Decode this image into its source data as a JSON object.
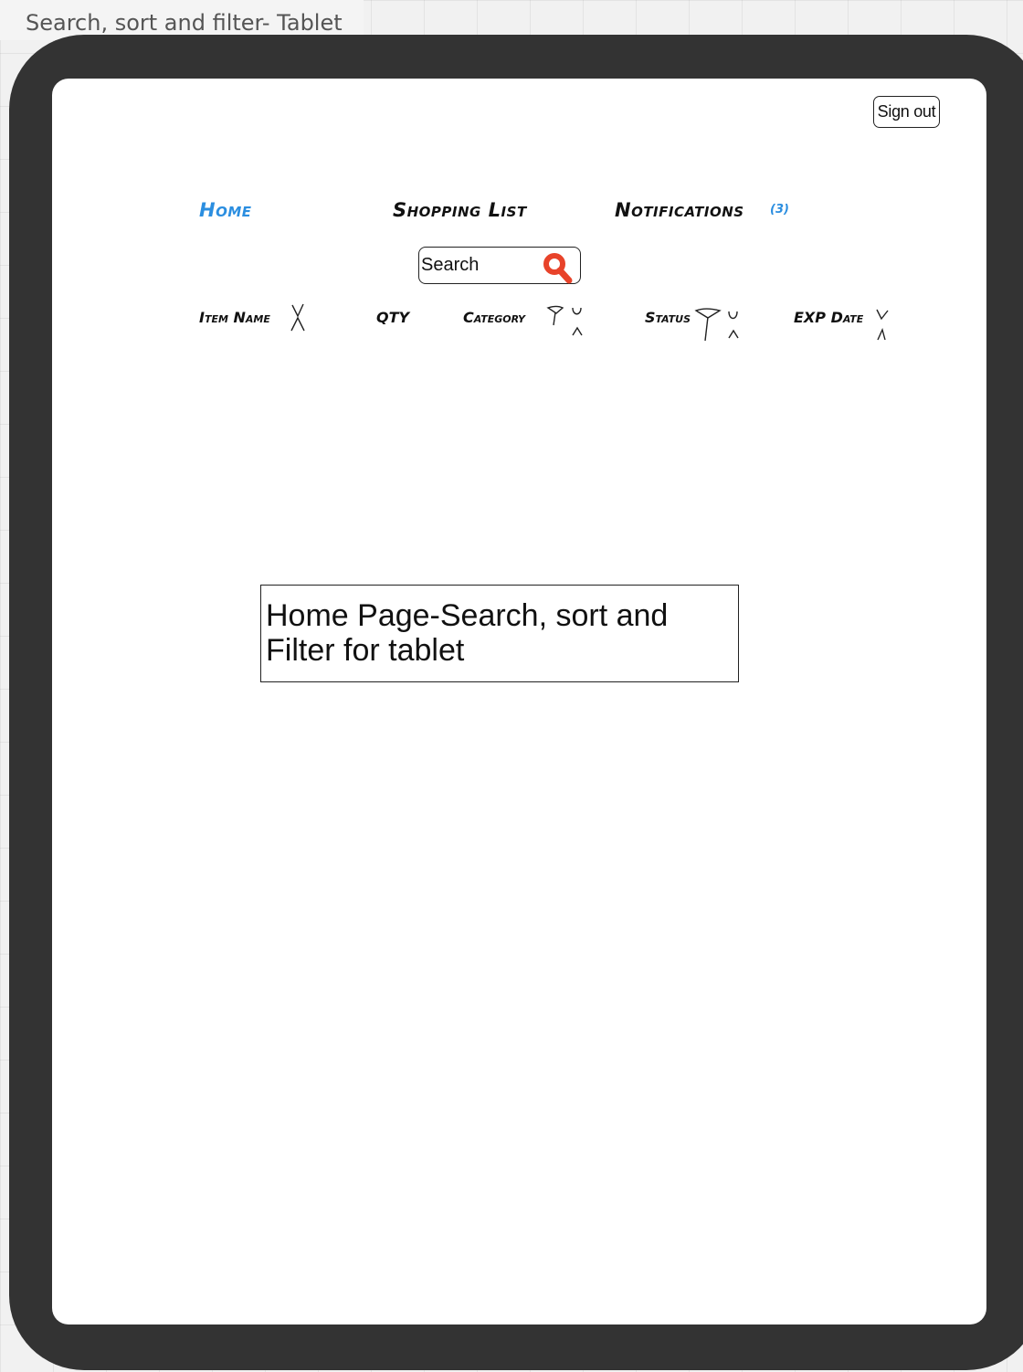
{
  "frame": {
    "title": "Search, sort and filter- Tablet"
  },
  "header": {
    "signout_label": "Sign out"
  },
  "nav": {
    "home": "Home",
    "shopping_list": "Shopping List",
    "notifications": "Notifications",
    "notifications_count": "(3)"
  },
  "search": {
    "placeholder": "Search"
  },
  "table": {
    "columns": {
      "item_name": "Item Name",
      "qty": "QTY",
      "category": "Category",
      "status": "Status",
      "exp_date": "EXP Date"
    }
  },
  "caption": {
    "text": "Home Page-Search, sort and Filter for tablet"
  },
  "colors": {
    "accent": "#2b8ee0",
    "tablet_frame": "#333333",
    "search_icon": "#e8432a"
  },
  "icons": {
    "search": "magnifier-icon",
    "sort": "sort-arrows-icon",
    "filter": "funnel-icon"
  }
}
